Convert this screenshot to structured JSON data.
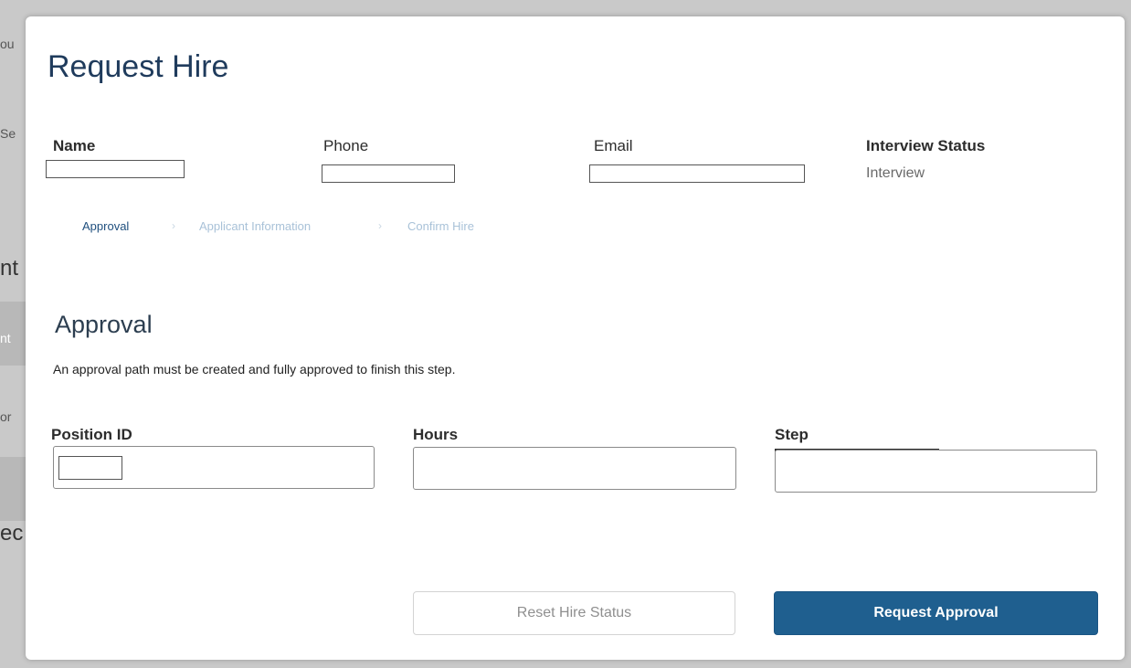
{
  "modal": {
    "title": "Request Hire",
    "fields": {
      "name": {
        "label": "Name",
        "value": ""
      },
      "phone": {
        "label": "Phone",
        "value": ""
      },
      "email": {
        "label": "Email",
        "value": ""
      },
      "interview_status": {
        "label": "Interview Status",
        "value": "Interview"
      }
    },
    "steps": [
      {
        "label": "Approval",
        "active": true
      },
      {
        "label": "Applicant Information",
        "active": false
      },
      {
        "label": "Confirm Hire",
        "active": false
      }
    ],
    "step_separator": "›",
    "section": {
      "title": "Approval",
      "description": "An approval path must be created and fully approved to finish this step."
    },
    "form": {
      "position_id": {
        "label": "Position ID",
        "value": ""
      },
      "hours": {
        "label": "Hours",
        "value": ""
      },
      "step": {
        "label": "Step",
        "value": ""
      }
    },
    "buttons": {
      "reset": "Reset Hire Status",
      "request": "Request Approval"
    }
  },
  "background_fragments": [
    "ou",
    "Se",
    "nt",
    "nt",
    "or",
    "ec"
  ],
  "colors": {
    "title": "#1f3b5c",
    "accent": "#1f5f8f",
    "step_active": "#1f4f7e",
    "step_inactive": "#a9c2d8"
  }
}
